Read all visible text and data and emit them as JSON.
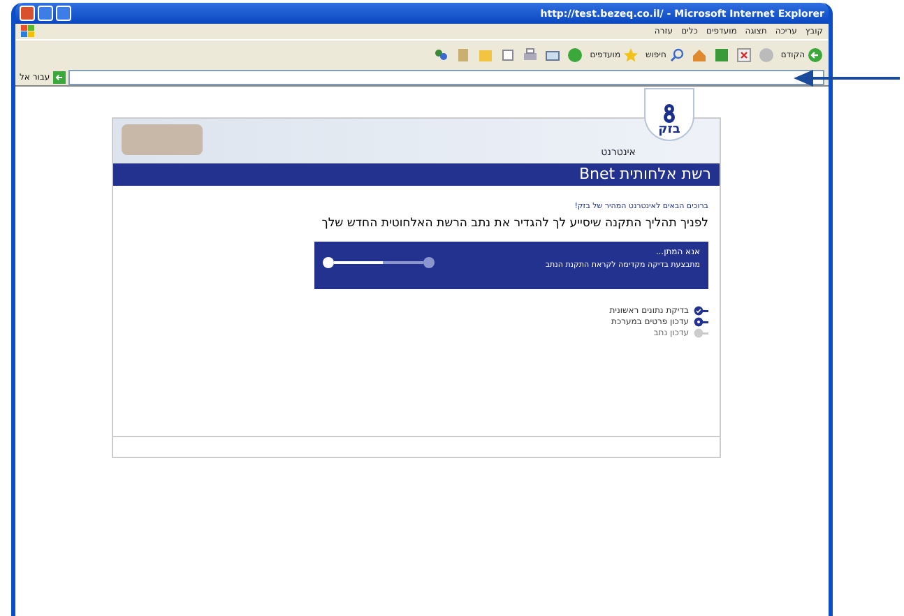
{
  "window": {
    "title": "http://test.bezeq.co.il/ - Microsoft Internet Explorer"
  },
  "menu": [
    "קובץ",
    "עריכה",
    "תצוגה",
    "מועדפים",
    "כלים",
    "עזרה"
  ],
  "toolbar": {
    "back": "הקודם",
    "search": "חיפוש",
    "favorites": "מועדפים"
  },
  "address_bar": {
    "go": "עבור אל"
  },
  "page": {
    "logo": "בזק",
    "section": "אינטרנט",
    "header": "רשת אלחותית Bnet",
    "welcome": "ברוכים הבאים לאינטרנט המהיר של בזק!",
    "intro": "לפניך תהליך התקנה שיסייע לך להגדיר את נתב הרשת האלחוטית החדש שלך",
    "status": {
      "title": "אנא המתן...",
      "message": "מתבצעת בדיקה מקדימה לקראת התקנת הנתב",
      "level": 0.55
    },
    "steps": [
      {
        "label": "בדיקת נתונים ראשונית",
        "kind": "done"
      },
      {
        "label": "עדכון פרטים במערכת",
        "kind": "active"
      },
      {
        "label": "עדכון נתב",
        "kind": "pending"
      }
    ]
  }
}
